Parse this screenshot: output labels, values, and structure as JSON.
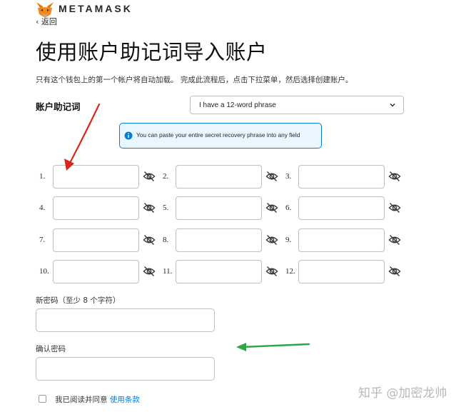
{
  "header": {
    "brand": "METAMASK",
    "back_label": "‹ 返回",
    "logo_icon": "fox-icon"
  },
  "page": {
    "title": "使用账户助记词导入账户",
    "intro": "只有这个钱包上的第一个帐户将自动加载。 完成此流程后，点击下拉菜单，然后选择创建账户。"
  },
  "phrase": {
    "label": "账户助记词",
    "select_value": "I have a 12-word phrase",
    "info": "You can paste your entire secret recovery phrase into any field",
    "fields": [
      {
        "num": "1."
      },
      {
        "num": "2."
      },
      {
        "num": "3."
      },
      {
        "num": "4."
      },
      {
        "num": "5."
      },
      {
        "num": "6."
      },
      {
        "num": "7."
      },
      {
        "num": "8."
      },
      {
        "num": "9."
      },
      {
        "num": "10."
      },
      {
        "num": "11."
      },
      {
        "num": "12."
      }
    ]
  },
  "password": {
    "new_label": "新密码（至少 8 个字符）",
    "confirm_label": "确认密码"
  },
  "terms": {
    "prefix": "我已阅读并同意 ",
    "link": "使用条款"
  },
  "watermark": "知乎 @加密龙帅",
  "colors": {
    "accent": "#037dd6",
    "info_bg": "#eaf6ff",
    "arrow_red": "#d9261c",
    "arrow_green": "#2ea641"
  }
}
